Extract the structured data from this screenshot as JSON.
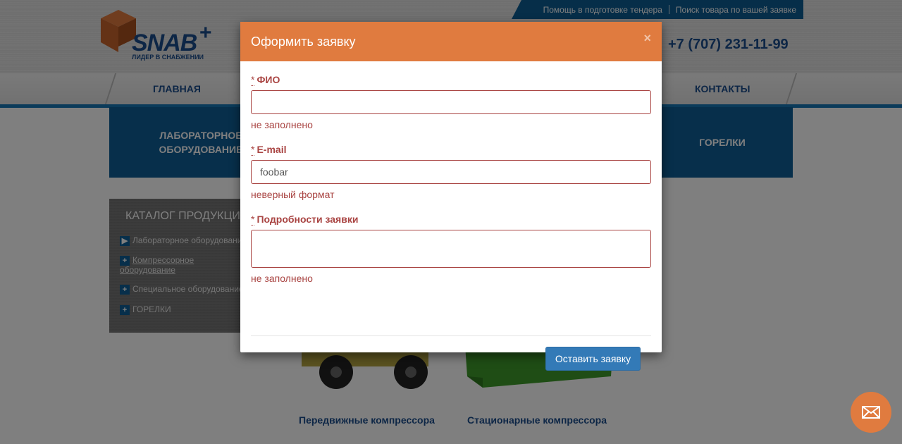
{
  "header": {
    "top_links": [
      "Помощь в подготовке тендера",
      "Поиск товара по вашей заявке"
    ],
    "logo_text": "SNAB",
    "logo_plus": "+",
    "logo_tagline": "ЛИДЕР В СНАБЖЕНИИ",
    "phone": "+7 (707) 231-11-99"
  },
  "nav": {
    "items": [
      "ГЛАВНАЯ",
      "КОНТАКТЫ"
    ]
  },
  "categories": {
    "lab_line1": "ЛАБОРАТОРНОЕ",
    "lab_line2": "ОБОРУДОВАНИЕ",
    "burners": "ГОРЕЛКИ"
  },
  "sidebar": {
    "title": "КАТАЛОГ ПРОДУКЦИИ",
    "items": [
      {
        "icon": "▶",
        "label": "Лабораторное оборудование"
      },
      {
        "icon": "+",
        "label_line1": "Компрессорное",
        "label_line2": "оборудование"
      },
      {
        "icon": "+",
        "label": "Специальное оборудование"
      },
      {
        "icon": "+",
        "label": "ГОРЕЛКИ"
      }
    ]
  },
  "products": [
    {
      "label": "Передвижные компрессора"
    },
    {
      "label": "Стационарные компрессора"
    }
  ],
  "modal": {
    "title": "Оформить заявку",
    "close_label": "×",
    "required_marker": "*",
    "fields": {
      "fio": {
        "label": "ФИО",
        "value": "",
        "error": "не заполнено"
      },
      "email": {
        "label": "E-mail",
        "value": "foobar",
        "error": "неверный формат"
      },
      "details": {
        "label": "Подробности заявки",
        "value": "",
        "error": "не заполнено"
      }
    },
    "submit_label": "Оставить заявку"
  },
  "colors": {
    "accent_orange": "#e07b3f",
    "brand_blue": "#0f5f96",
    "error_red": "#a94442",
    "button_blue": "#337ab7"
  },
  "icons": {
    "close": "close-icon",
    "mail": "envelope-icon",
    "logo": "cube-logo-icon"
  }
}
